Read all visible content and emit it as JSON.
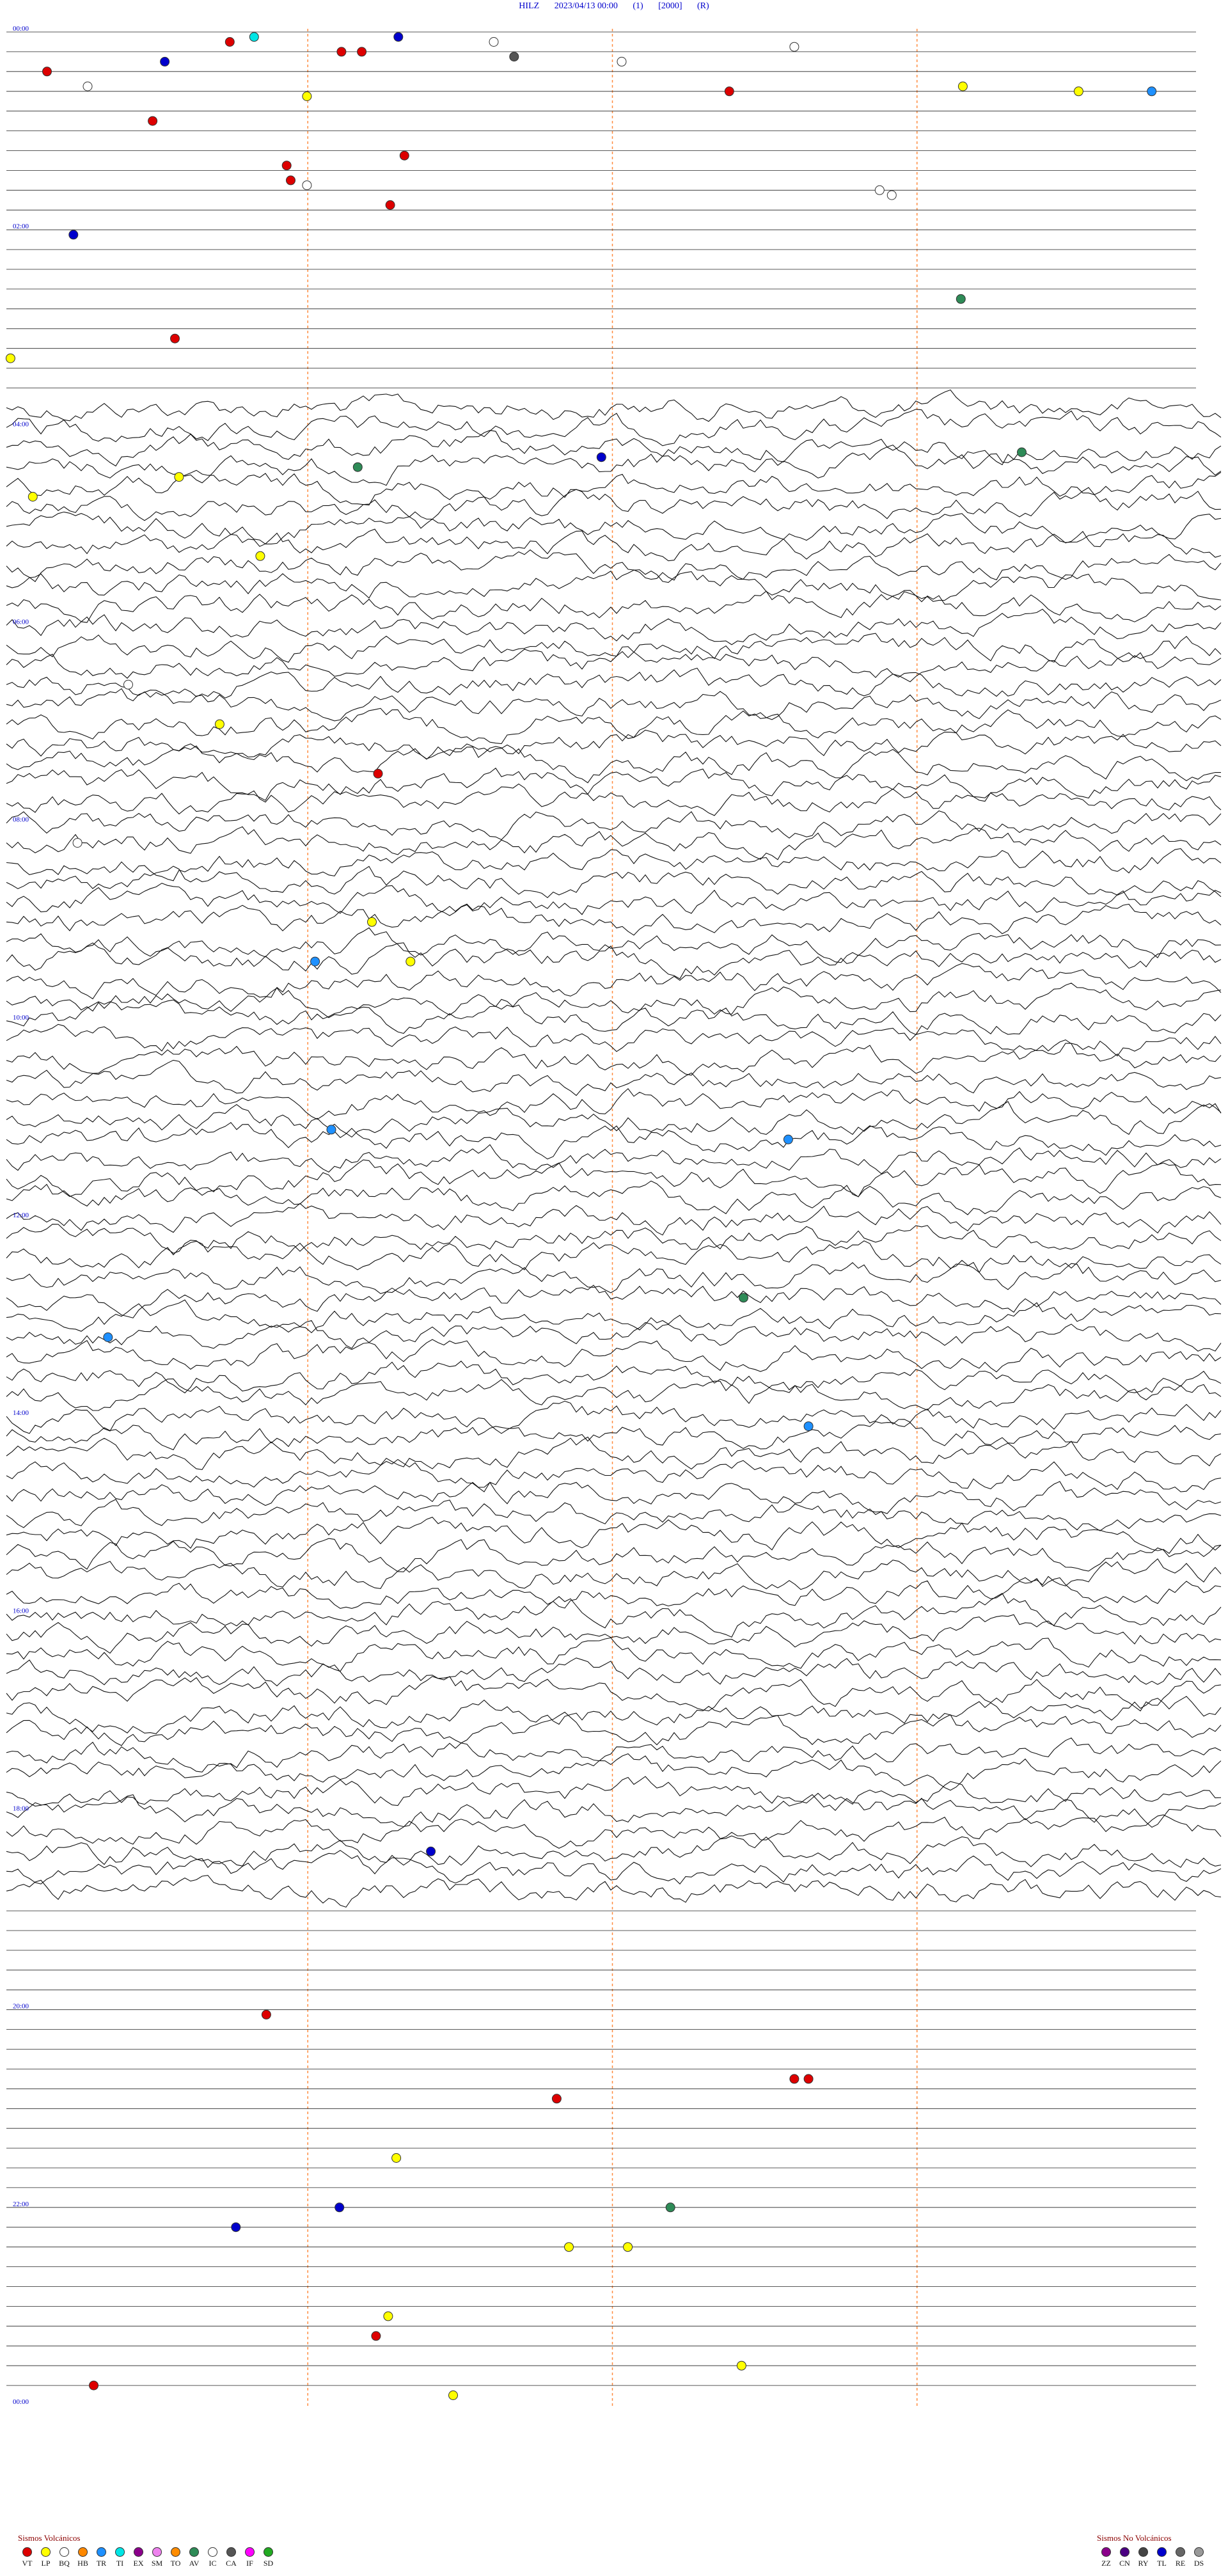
{
  "header": {
    "station": "HILZ",
    "datetime": "2023/04/13 00:00",
    "index": "(1)",
    "gain": "[2000]",
    "flag": "(R)"
  },
  "legend_volcanic": {
    "title": "Sismos Volcánicos",
    "items": [
      {
        "code": "VT",
        "color": "#dd0000"
      },
      {
        "code": "LP",
        "color": "#ffff00"
      },
      {
        "code": "BQ",
        "color": "#ffffff"
      },
      {
        "code": "HB",
        "color": "#ff8800"
      },
      {
        "code": "TR",
        "color": "#1e90ff"
      },
      {
        "code": "TI",
        "color": "#00e5e5"
      },
      {
        "code": "EX",
        "color": "#8b008b"
      },
      {
        "code": "SM",
        "color": "#ee82ee"
      },
      {
        "code": "TO",
        "color": "#ff8c00"
      },
      {
        "code": "AV",
        "color": "#2e8b57"
      },
      {
        "code": "IC",
        "color": "#ffffff"
      },
      {
        "code": "CA",
        "color": "#555555"
      },
      {
        "code": "IF",
        "color": "#ff00ff"
      },
      {
        "code": "SD",
        "color": "#22aa22"
      }
    ]
  },
  "legend_nonvolcanic": {
    "title": "Sismos No Volcánicos",
    "items": [
      {
        "code": "ZZ",
        "color": "#8b008b"
      },
      {
        "code": "CN",
        "color": "#4b0082"
      },
      {
        "code": "RY",
        "color": "#444444"
      },
      {
        "code": "TL",
        "color": "#0000cc"
      },
      {
        "code": "RE",
        "color": "#666666"
      },
      {
        "code": "DS",
        "color": "#999999"
      }
    ]
  },
  "chart_data": {
    "type": "scatter",
    "title": "HILZ 2023/04/13 00:00 (1) [2000] (R)",
    "x_unit": "minutes past hour",
    "xlim": [
      0,
      60
    ],
    "y_unit": "hour of day",
    "ylim": [
      0,
      24
    ],
    "hour_labels": [
      "00:00",
      "02:00",
      "04:00",
      "06:00",
      "08:00",
      "10:00",
      "12:00",
      "14:00",
      "16:00",
      "18:00",
      "20:00",
      "22:00",
      "00:00"
    ],
    "traces_per_hour": 5,
    "events": [
      {
        "t": 0.05,
        "m": 12.2,
        "type": "TI"
      },
      {
        "t": 0.05,
        "m": 19.3,
        "type": "TL"
      },
      {
        "t": 0.1,
        "m": 11.0,
        "type": "VT"
      },
      {
        "t": 0.2,
        "m": 16.5,
        "type": "VT"
      },
      {
        "t": 0.2,
        "m": 17.5,
        "type": "VT"
      },
      {
        "t": 0.1,
        "m": 24.0,
        "type": "IC"
      },
      {
        "t": 0.3,
        "m": 30.3,
        "type": "IC"
      },
      {
        "t": 0.15,
        "m": 38.8,
        "type": "IC"
      },
      {
        "t": 0.25,
        "m": 25.0,
        "type": "CA"
      },
      {
        "t": 0.3,
        "m": 7.8,
        "type": "TL"
      },
      {
        "t": 0.4,
        "m": 2.0,
        "type": "VT"
      },
      {
        "t": 0.55,
        "m": 4.0,
        "type": "IC"
      },
      {
        "t": 0.65,
        "m": 14.8,
        "type": "LP"
      },
      {
        "t": 0.6,
        "m": 35.6,
        "type": "VT"
      },
      {
        "t": 0.55,
        "m": 47.1,
        "type": "LP"
      },
      {
        "t": 0.6,
        "m": 52.8,
        "type": "LP"
      },
      {
        "t": 0.6,
        "m": 56.4,
        "type": "TR"
      },
      {
        "t": 0.9,
        "m": 7.2,
        "type": "VT"
      },
      {
        "t": 1.25,
        "m": 19.6,
        "type": "VT"
      },
      {
        "t": 1.35,
        "m": 13.8,
        "type": "VT"
      },
      {
        "t": 1.5,
        "m": 14.0,
        "type": "VT"
      },
      {
        "t": 1.55,
        "m": 14.8,
        "type": "IC"
      },
      {
        "t": 1.6,
        "m": 43.0,
        "type": "IC"
      },
      {
        "t": 1.65,
        "m": 43.6,
        "type": "IC"
      },
      {
        "t": 1.75,
        "m": 18.9,
        "type": "VT"
      },
      {
        "t": 2.05,
        "m": 3.3,
        "type": "TL"
      },
      {
        "t": 2.7,
        "m": 47.0,
        "type": "AV"
      },
      {
        "t": 3.1,
        "m": 8.3,
        "type": "VT"
      },
      {
        "t": 3.3,
        "m": 0.2,
        "type": "LP"
      },
      {
        "t": 4.3,
        "m": 29.3,
        "type": "TL"
      },
      {
        "t": 4.5,
        "m": 8.5,
        "type": "LP"
      },
      {
        "t": 4.7,
        "m": 1.3,
        "type": "LP"
      },
      {
        "t": 4.4,
        "m": 17.3,
        "type": "AV"
      },
      {
        "t": 4.25,
        "m": 50.0,
        "type": "AV"
      },
      {
        "t": 5.3,
        "m": 12.5,
        "type": "LP"
      },
      {
        "t": 6.6,
        "m": 6.0,
        "type": "IC"
      },
      {
        "t": 7.0,
        "m": 10.5,
        "type": "LP"
      },
      {
        "t": 7.5,
        "m": 18.3,
        "type": "VT"
      },
      {
        "t": 8.2,
        "m": 3.5,
        "type": "IC"
      },
      {
        "t": 9.0,
        "m": 18.0,
        "type": "LP"
      },
      {
        "t": 9.4,
        "m": 15.2,
        "type": "TR"
      },
      {
        "t": 9.4,
        "m": 19.9,
        "type": "LP"
      },
      {
        "t": 11.1,
        "m": 16.0,
        "type": "TR"
      },
      {
        "t": 11.2,
        "m": 38.5,
        "type": "TR"
      },
      {
        "t": 13.2,
        "m": 5.0,
        "type": "TR"
      },
      {
        "t": 12.8,
        "m": 36.3,
        "type": "AV"
      },
      {
        "t": 14.1,
        "m": 39.5,
        "type": "TR"
      },
      {
        "t": 18.4,
        "m": 20.9,
        "type": "TL"
      },
      {
        "t": 20.05,
        "m": 12.8,
        "type": "VT"
      },
      {
        "t": 20.7,
        "m": 38.8,
        "type": "VT"
      },
      {
        "t": 20.7,
        "m": 39.5,
        "type": "VT"
      },
      {
        "t": 20.9,
        "m": 27.1,
        "type": "VT"
      },
      {
        "t": 21.5,
        "m": 19.2,
        "type": "LP"
      },
      {
        "t": 22.0,
        "m": 16.4,
        "type": "TL"
      },
      {
        "t": 22.0,
        "m": 32.7,
        "type": "AV"
      },
      {
        "t": 22.2,
        "m": 11.3,
        "type": "TL"
      },
      {
        "t": 22.4,
        "m": 27.7,
        "type": "LP"
      },
      {
        "t": 22.4,
        "m": 30.6,
        "type": "LP"
      },
      {
        "t": 23.1,
        "m": 18.8,
        "type": "LP"
      },
      {
        "t": 23.3,
        "m": 18.2,
        "type": "VT"
      },
      {
        "t": 23.6,
        "m": 36.2,
        "type": "LP"
      },
      {
        "t": 23.8,
        "m": 4.3,
        "type": "VT"
      },
      {
        "t": 23.9,
        "m": 22.0,
        "type": "LP"
      }
    ]
  }
}
